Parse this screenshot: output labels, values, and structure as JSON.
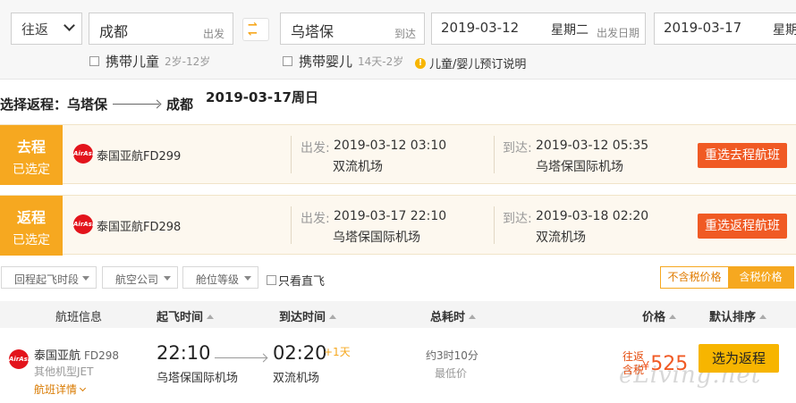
{
  "search": {
    "trip_type": "往返",
    "from_city": "成都",
    "from_tag": "出发",
    "to_city": "乌塔保",
    "to_tag": "到达",
    "dep_date": "2019-03-12",
    "dep_week": "星期二",
    "dep_tag": "出发日期",
    "ret_date": "2019-03-17",
    "ret_week": "星期",
    "child_label": "携带儿童",
    "child_range": "2岁-12岁",
    "infant_label": "携带婴儿",
    "infant_range": "14天-2岁",
    "info_text": "儿童/婴儿预订说明"
  },
  "route": {
    "prefix": "选择返程：乌塔保",
    "dest": "成都",
    "date": "2019-03-17周日"
  },
  "legs": [
    {
      "badge_top": "去程",
      "badge_bottom": "已选定",
      "airline": "泰国亚航FD299",
      "dep_label": "出发:",
      "dep_time": "2019-03-12 03:10",
      "dep_airport": "双流机场",
      "arr_label": "到达:",
      "arr_time": "2019-03-12 05:35",
      "arr_airport": "乌塔保国际机场",
      "button": "重选去程航班"
    },
    {
      "badge_top": "返程",
      "badge_bottom": "已选定",
      "airline": "泰国亚航FD298",
      "dep_label": "出发:",
      "dep_time": "2019-03-17 22:10",
      "dep_airport": "乌塔保国际机场",
      "arr_label": "到达:",
      "arr_time": "2019-03-18 02:20",
      "arr_airport": "双流机场",
      "button": "重选返程航班"
    }
  ],
  "filters": {
    "depart_period": "回程起飞时段",
    "airline": "航空公司",
    "cabin": "舱位等级",
    "nonstop": "只看直飞",
    "tax_excluded": "不含税价格",
    "tax_included": "含税价格"
  },
  "list_header": {
    "info": "航班信息",
    "dep": "起飞时间",
    "arr": "到达时间",
    "duration": "总耗时",
    "price": "价格",
    "sort": "默认排序"
  },
  "flights": [
    {
      "airline": "泰国亚航",
      "flight_no": "FD298",
      "plane": "其他机型JET",
      "detail": "航班详情",
      "dep_time": "22:10",
      "dep_airport": "乌塔保国际机场",
      "arr_time": "02:20",
      "plus_day": "+1天",
      "arr_airport": "双流机场",
      "duration": "约3时10分",
      "lowest": "最低价",
      "price_line1": "往返",
      "price_line2": "含税",
      "currency": "¥",
      "price": "525",
      "button": "选为返程"
    }
  ],
  "logo_text": "AirAsia",
  "watermark": "eLiving.net",
  "colors": {
    "accent": "#f6a820",
    "button_red": "#f05a24",
    "button_yellow": "#f7b500",
    "price": "#f05a24"
  }
}
